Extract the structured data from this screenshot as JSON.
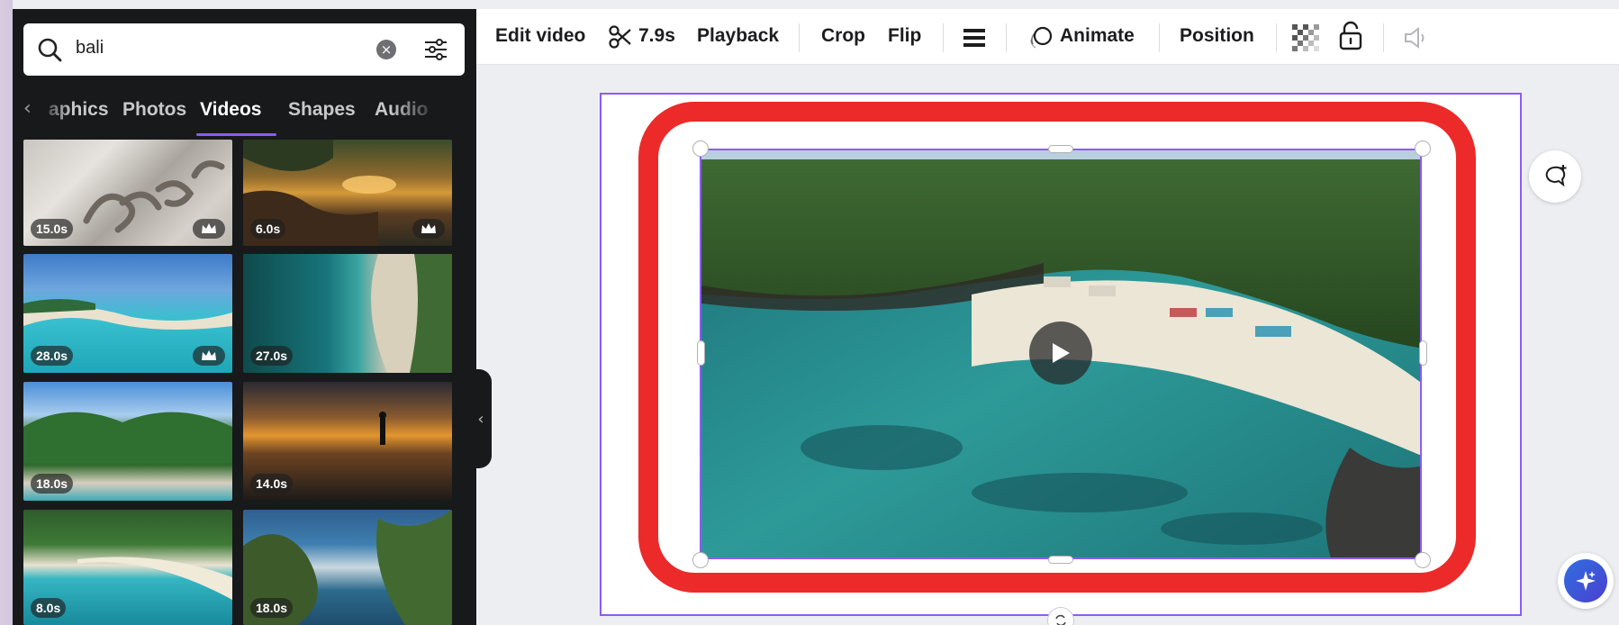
{
  "search": {
    "query": "bali"
  },
  "tabs": {
    "items": [
      {
        "label": "aphics"
      },
      {
        "label": "Photos"
      },
      {
        "label": "Videos"
      },
      {
        "label": "Shapes"
      },
      {
        "label": "Audio"
      }
    ],
    "active": "Videos"
  },
  "results": [
    {
      "duration": "15.0s",
      "premium": true
    },
    {
      "duration": "6.0s",
      "premium": true
    },
    {
      "duration": "28.0s",
      "premium": true
    },
    {
      "duration": "27.0s",
      "premium": false
    },
    {
      "duration": "18.0s",
      "premium": false
    },
    {
      "duration": "14.0s",
      "premium": false
    },
    {
      "duration": "8.0s",
      "premium": false
    },
    {
      "duration": "18.0s",
      "premium": false
    }
  ],
  "toolbar": {
    "edit_video": "Edit video",
    "trim_duration": "7.9s",
    "playback": "Playback",
    "crop": "Crop",
    "flip": "Flip",
    "animate": "Animate",
    "position": "Position"
  },
  "colors": {
    "accent": "#8b5cf6",
    "highlight": "#ec2a2a",
    "panel": "#18191b"
  }
}
